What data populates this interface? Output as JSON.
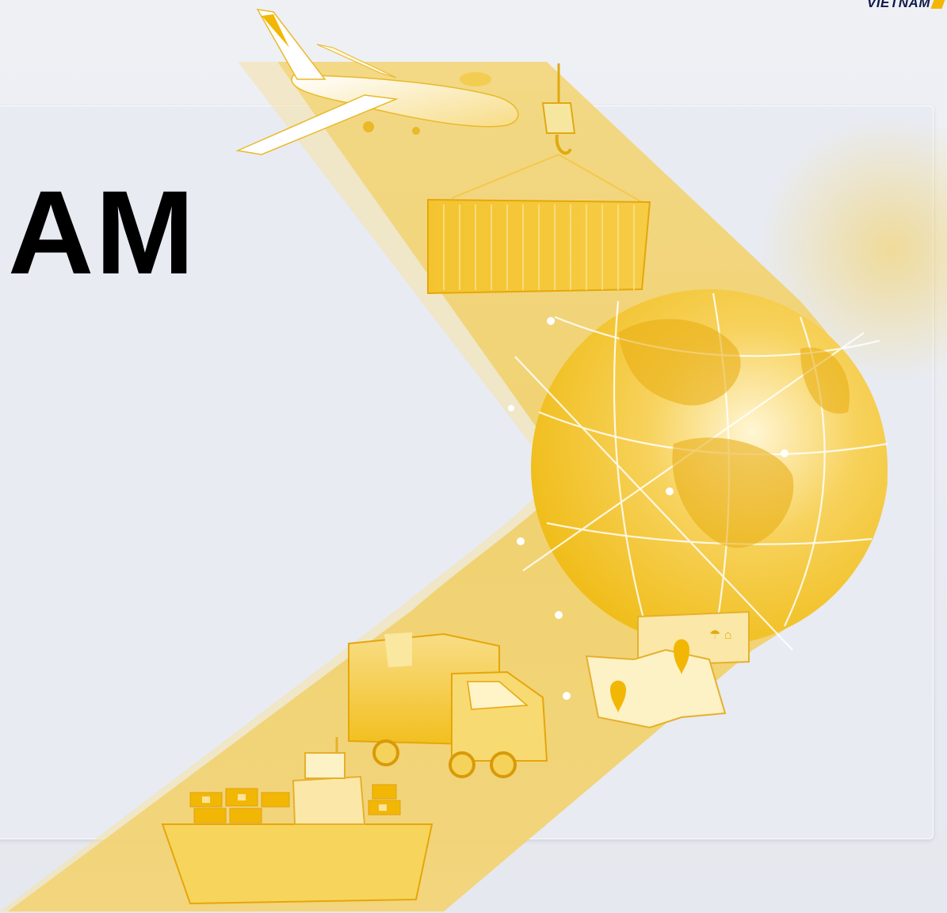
{
  "slide": {
    "title": "AM",
    "brand_text": "VIETNAM"
  },
  "colors": {
    "background": "#e9ecf2",
    "panel": "#e8ebf2",
    "accent": "#f2b705",
    "accent_light": "#f6d87a",
    "title_text": "#000000",
    "brand_text": "#0f1a4a"
  },
  "illustration": {
    "elements": [
      "airplane-icon",
      "crane-hook-icon",
      "shipping-container-icon",
      "globe-icon",
      "delivery-truck-icon",
      "cargo-box-icon",
      "map-pin-icon",
      "container-ship-icon"
    ]
  }
}
